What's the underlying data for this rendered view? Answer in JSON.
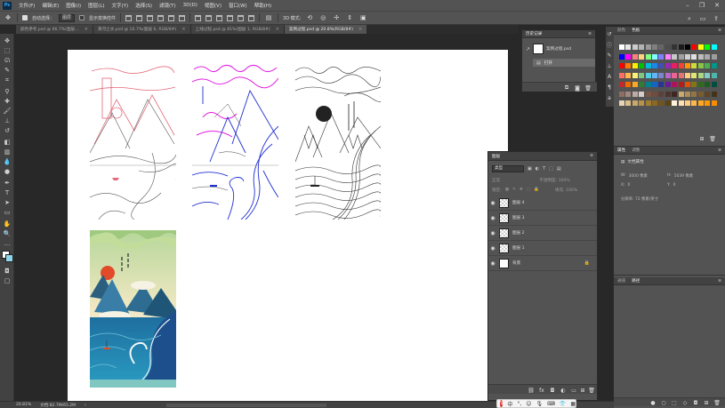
{
  "menu": {
    "logo": "Ps",
    "items": [
      "文件(F)",
      "编辑(E)",
      "图像(I)",
      "图层(L)",
      "文字(Y)",
      "选择(S)",
      "滤镜(T)",
      "3D(D)",
      "视图(V)",
      "窗口(W)",
      "帮助(H)"
    ]
  },
  "options": {
    "auto_select_label": "自动选择：",
    "auto_select_value": "图层",
    "show_transform_label": "显示变换控件"
  },
  "tabs": [
    {
      "label": "颜色参考.psd @ 66.7%(图层…",
      "active": false
    },
    {
      "label": "黄河之水.psd @ 16.7%(图层 6, RGB/8#)",
      "active": false
    },
    {
      "label": "上线过程.psd @ 81%(图层 1, RGB/8#)",
      "active": false
    },
    {
      "label": "案例过程.psd @ 20.8%(RGB/8#)",
      "active": true
    }
  ],
  "history": {
    "title": "历史记录",
    "snapshot_label": "案例过程.psd",
    "step_label": "打开"
  },
  "layers": {
    "title": "图层",
    "kind_label": "类型",
    "mode_label": "正常",
    "opacity_label": "不透明度: 100%",
    "lock_label": "锁定:",
    "fill_label": "填充: 100%",
    "rows": [
      {
        "name": "图层 4",
        "type": "transparent",
        "locked": false
      },
      {
        "name": "图层 3",
        "type": "transparent",
        "locked": false
      },
      {
        "name": "图层 2",
        "type": "transparent",
        "locked": false
      },
      {
        "name": "图层 1",
        "type": "transparent",
        "locked": false
      },
      {
        "name": "背景",
        "type": "white",
        "locked": true
      }
    ]
  },
  "swatches_panel": {
    "tab1": "颜色",
    "tab2": "色板"
  },
  "properties_panel": {
    "tab1": "属性",
    "tab2": "调整",
    "doc_props": "文档属性",
    "w_label": "W:",
    "w_value": "3000 像素",
    "h_label": "H:",
    "h_value": "5039 像素",
    "x_label": "X:",
    "x_value": "0",
    "y_label": "Y:",
    "y_value": "0",
    "resolution": "分辨率: 72 像素/英寸"
  },
  "paths_panel": {
    "tab1": "通道",
    "tab2": "路径"
  },
  "status": {
    "zoom": "20.81%",
    "doc": "文档:82.7M/65.2M"
  },
  "colors": {
    "canvas_bg": "#ffffff",
    "app_bg": "#282828",
    "panel": "#535353",
    "sketch_red": "#e36a7a",
    "sketch_magenta": "#e020e0",
    "sketch_blue": "#2030d0",
    "final_sea": "#2b7fb0",
    "final_sun": "#e14b2a"
  }
}
